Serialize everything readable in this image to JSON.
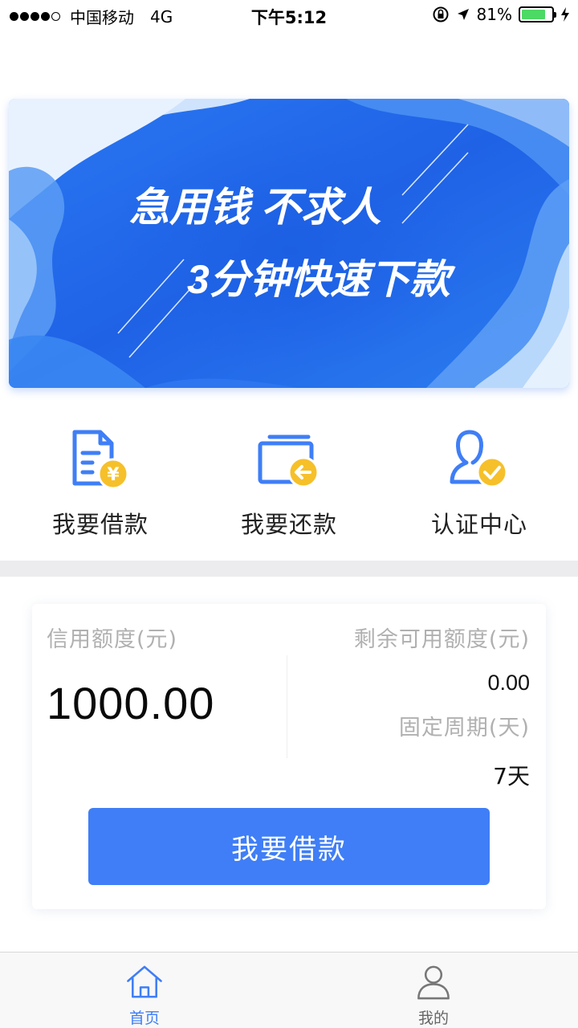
{
  "status_bar": {
    "carrier": "中国移动",
    "network": "4G",
    "time": "下午5:12",
    "battery": "81%"
  },
  "banner": {
    "line1": "急用钱 不求人",
    "line2": "3分钟快速下款"
  },
  "actions": [
    {
      "label": "我要借款",
      "icon": "document-yen-icon"
    },
    {
      "label": "我要还款",
      "icon": "wallet-return-icon"
    },
    {
      "label": "认证中心",
      "icon": "user-verified-icon"
    }
  ],
  "credit": {
    "limit_label": "信用额度(元)",
    "limit_value": "1000.00",
    "available_label": "剩余可用额度(元)",
    "available_value": "0.00",
    "period_label": "固定周期(天)",
    "period_value": "7天",
    "button_label": "我要借款"
  },
  "tabbar": {
    "home": "首页",
    "mine": "我的"
  },
  "colors": {
    "accent": "#3f7ef6",
    "badge": "#f6c02a",
    "battery": "#4cd964"
  }
}
